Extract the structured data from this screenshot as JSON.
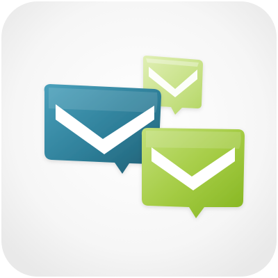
{
  "icon": {
    "name": "mail-envelopes-app-icon",
    "background_color": "#f5f5f5",
    "colors": {
      "blue_dark": "#1f5e73",
      "blue_light": "#4aa0bb",
      "green_dark": "#84b51f",
      "green_light": "#c3e07a",
      "green_small_light": "#d3e89e"
    }
  }
}
